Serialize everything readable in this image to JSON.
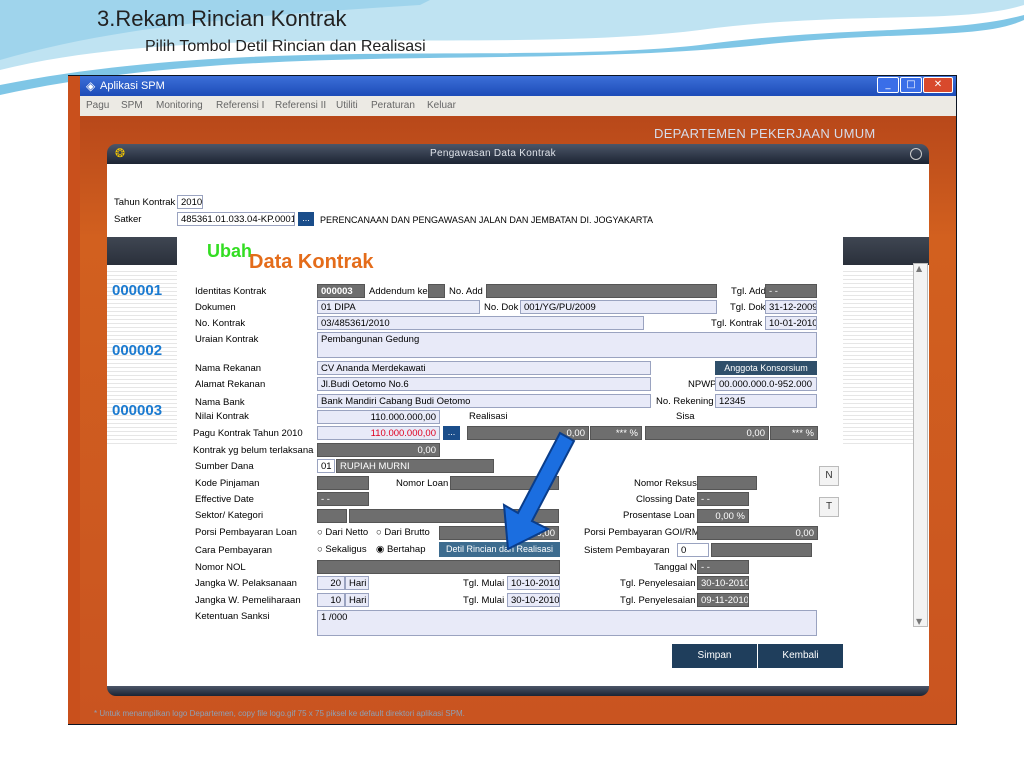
{
  "slide": {
    "title": "3.Rekam Rincian Kontrak",
    "subtitle": "Pilih Tombol Detil Rincian dan Realisasi"
  },
  "window": {
    "title": "Aplikasi SPM",
    "menu": [
      "Pagu",
      "SPM",
      "Monitoring",
      "Referensi I",
      "Referensi II",
      "Utiliti",
      "Peraturan",
      "Keluar"
    ],
    "department": "DEPARTEMEN PEKERJAAN UMUM",
    "dialog_title": "Pengawasan Data Kontrak"
  },
  "header": {
    "tahun_label": "Tahun Kontrak",
    "tahun_value": "2010",
    "satker_label": "Satker",
    "satker_value": "485361.01.033.04-KP.0001",
    "satker_btn": "...",
    "satker_desc": "PERENCANAAN DAN PENGAWASAN JALAN DAN JEMBATAN DI. JOGYAKARTA"
  },
  "heading": {
    "ubah": "Ubah",
    "data_kontrak": "Data Kontrak"
  },
  "tabs": [
    "000001",
    "000002",
    "000003"
  ],
  "form": {
    "identitas_label": "Identitas Kontrak",
    "identitas_value": "000003",
    "addendum_label": "Addendum ke",
    "no_add_label": "No. Add",
    "tgl_add_label": "Tgl. Add",
    "tgl_add_value": "- -",
    "dokumen_label": "Dokumen",
    "dokumen_value": "01  DIPA",
    "no_dok_label": "No. Dok",
    "no_dok_value": "001/YG/PU/2009",
    "tgl_dok_label": "Tgl. Dok",
    "tgl_dok_value": "31-12-2009",
    "no_kontrak_label": "No. Kontrak",
    "no_kontrak_value": "03/485361/2010",
    "tgl_kontrak_label": "Tgl. Kontrak",
    "tgl_kontrak_value": "10-01-2010",
    "uraian_label": "Uraian Kontrak",
    "uraian_value": "Pembangunan Gedung",
    "nama_rekanan_label": "Nama Rekanan",
    "nama_rekanan_value": "CV Ananda Merdekawati",
    "anggota_btn": "Anggota Konsorsium",
    "alamat_label": "Alamat Rekanan",
    "alamat_value": "Jl.Budi Oetomo No.6",
    "npwp_label": "NPWP",
    "npwp_value": "00.000.000.0-952.000",
    "bank_label": "Nama Bank",
    "bank_value": "Bank Mandiri Cabang Budi Oetomo",
    "no_rek_label": "No. Rekening",
    "no_rek_value": "12345",
    "nilai_label": "Nilai Kontrak",
    "nilai_value": "110.000.000,00",
    "realisasi_label": "Realisasi",
    "sisa_label": "Sisa",
    "pagu_label": "Pagu Kontrak Tahun 2010",
    "pagu_value": "110.000.000,00",
    "pagu_btn": "...",
    "realisasi_value": "0,00",
    "realisasi_pct": "*** %",
    "sisa_value": "0,00",
    "sisa_pct": "*** %",
    "belum_label": "Kontrak yg belum terlaksana",
    "belum_value": "0,00",
    "sumber_label": "Sumber Dana",
    "sumber_code": "01",
    "sumber_value": "RUPIAH MURNI",
    "kode_pinjaman_label": "Kode Pinjaman",
    "nomor_loan_label": "Nomor Loan",
    "nomor_reksus_label": "Nomor Reksus",
    "effective_label": "Effective Date",
    "effective_value": "- -",
    "closing_label": "Clossing Date",
    "closing_value": "- -",
    "sektor_label": "Sektor/ Kategori",
    "prosentase_label": "Prosentase Loan",
    "prosentase_value": "0,00  %",
    "porsi_label": "Porsi Pembayaran Loan",
    "dari_netto": "Dari Netto",
    "dari_brutto": "Dari Brutto",
    "porsi_value": "0,00",
    "porsi_goi_label": "Porsi Pembayaran GOI/RM",
    "porsi_goi_value": "0,00",
    "cara_label": "Cara Pembayaran",
    "sekaligus": "Sekaligus",
    "bertahap": "Bertahap",
    "detil_btn": "Detil Rincian dan Realisasi",
    "sistem_label": "Sistem Pembayaran",
    "sistem_value": "0",
    "nomor_nol_label": "Nomor NOL",
    "tanggal_nol_label": "Tanggal NOL",
    "tanggal_nol_value": "- -",
    "jw_pelaksanaan_label": "Jangka W. Pelaksanaan",
    "jw_pelaksanaan_value": "20",
    "hari1": "Hari",
    "tgl_mulai1_label": "Tgl. Mulai",
    "tgl_mulai1_value": "10-10-2010",
    "tgl_peny1_label": "Tgl. Penyelesaian",
    "tgl_peny1_value": "30-10-2010",
    "jw_pemeliharaan_label": "Jangka W. Pemeliharaan",
    "jw_pemeliharaan_value": "10",
    "hari2": "Hari",
    "tgl_mulai2_label": "Tgl. Mulai",
    "tgl_mulai2_value": "30-10-2010",
    "tgl_peny2_label": "Tgl. Penyelesaian",
    "tgl_peny2_value": "09-11-2010",
    "sanksi_label": "Ketentuan Sanksi",
    "sanksi_value": "1 /000"
  },
  "side_buttons": [
    "N",
    "T"
  ],
  "actions": {
    "simpan": "Simpan",
    "kembali": "Kembali"
  },
  "footer": {
    "hint": "* Untuk menampilkan logo Departemen, copy file logo.gif 75 x 75 piksel ke default direktori aplikasi SPM."
  },
  "colors": {
    "orange": "#c9501c",
    "accent": "#1a7ad0",
    "dark_field": "#6e6e6e",
    "button": "#2f4f6a"
  }
}
